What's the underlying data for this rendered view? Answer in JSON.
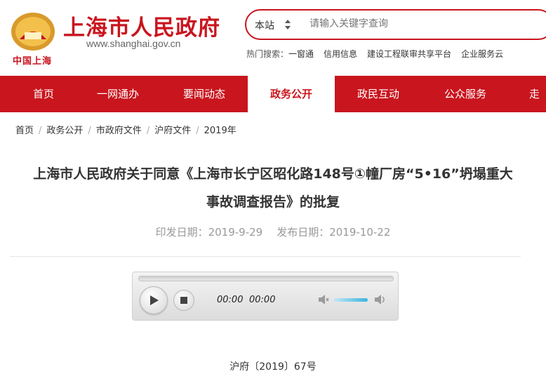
{
  "header": {
    "title": "上海市人民政府",
    "url": "www.shanghai.gov.cn",
    "logo_text": "中国上海",
    "emblem_text": "上海"
  },
  "search": {
    "scope": "本站",
    "placeholder": "请输入关键字查询"
  },
  "hot_search": {
    "label": "热门搜索：",
    "links": [
      "一窗通",
      "信用信息",
      "建设工程联审共享平台",
      "企业服务云"
    ]
  },
  "nav": {
    "items": [
      "首页",
      "一网通办",
      "要闻动态",
      "政务公开",
      "政民互动",
      "公众服务",
      "走进"
    ],
    "active_index": 3
  },
  "breadcrumb": [
    "首页",
    "政务公开",
    "市政府文件",
    "沪府文件",
    "2019年"
  ],
  "article": {
    "title_line1": "上海市人民政府关于同意《上海市长宁区昭化路148号①幢厂房“5•16”坍塌重大",
    "title_line2": "事故调查报告》的批复",
    "issue_date": "印发日期：2019-9-29",
    "publish_date": "发布日期：2019-10-22",
    "doc_number": "沪府〔2019〕67号"
  },
  "player": {
    "current_time": "00:00",
    "duration": "00:00",
    "volume": 0.8
  },
  "colors": {
    "brand_red": "#c9151e"
  }
}
